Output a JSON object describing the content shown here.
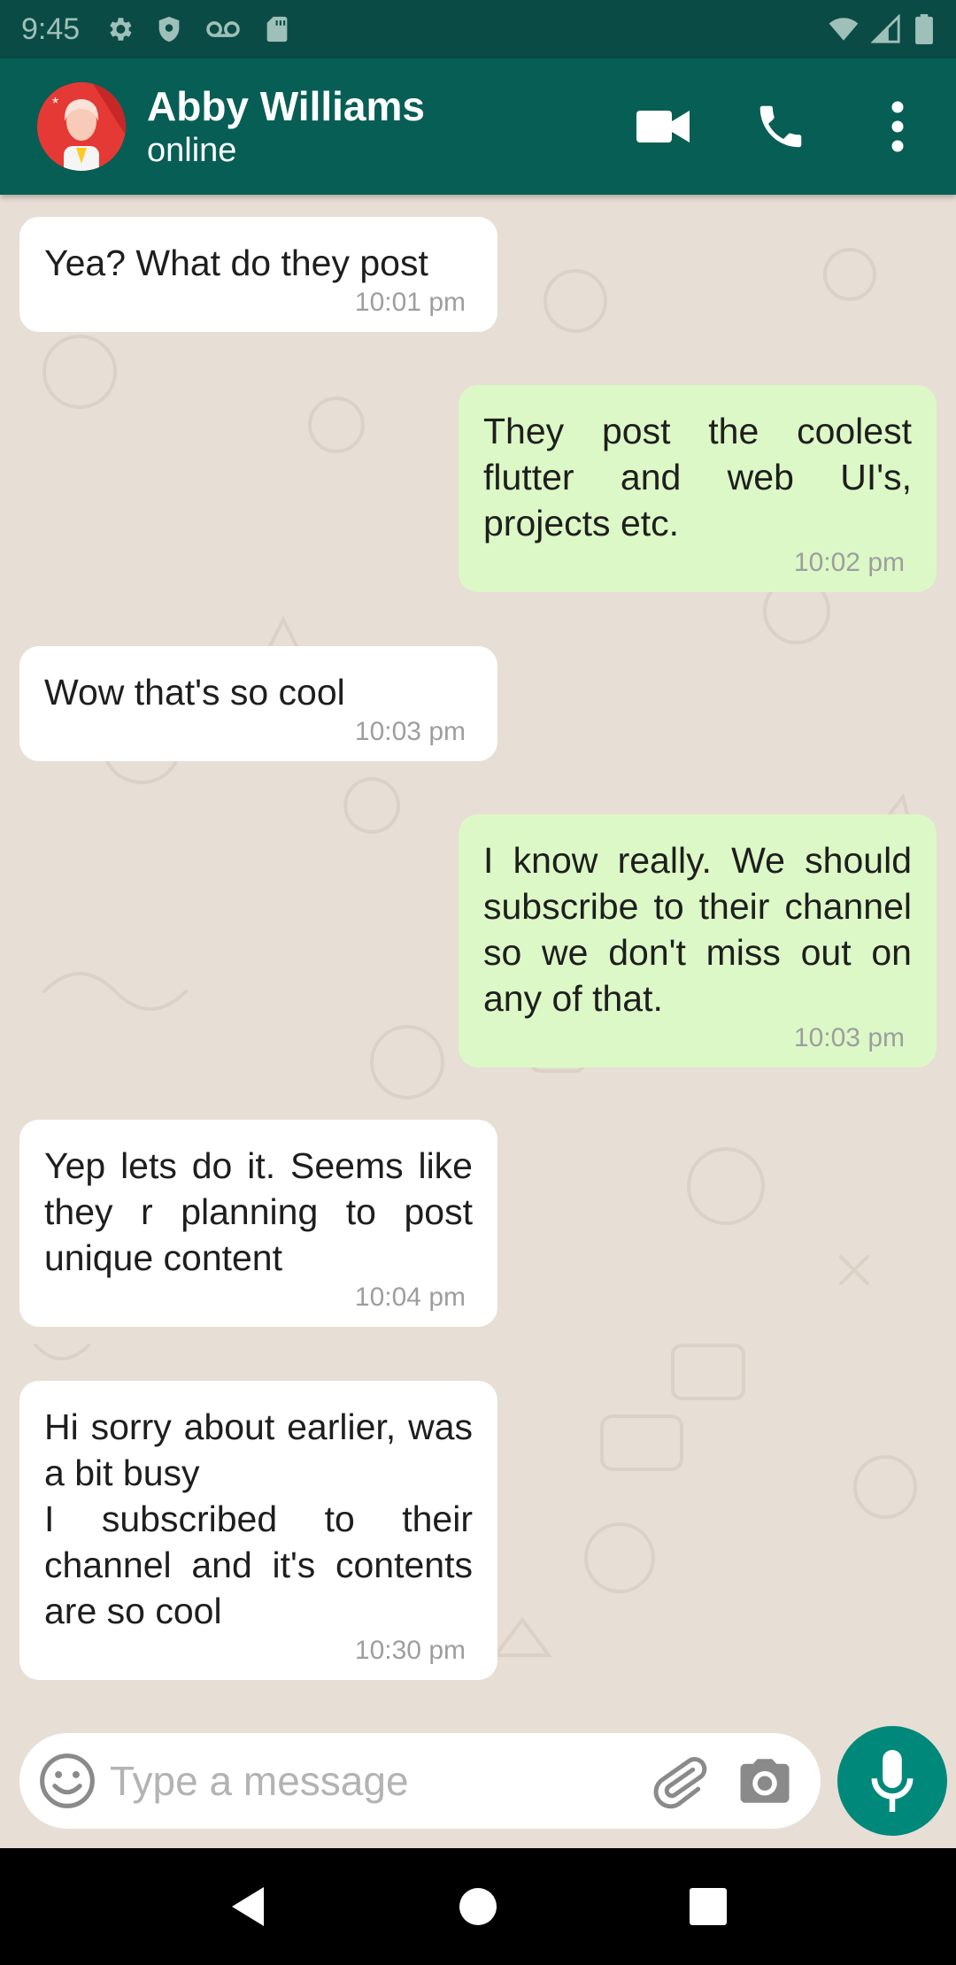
{
  "status_bar": {
    "time": "9:45",
    "left_icons": [
      "settings-icon",
      "shield-icon",
      "voicemail-icon",
      "sd-card-icon"
    ],
    "right_icons": [
      "wifi-icon",
      "cell-signal-icon",
      "battery-icon"
    ]
  },
  "header": {
    "contact_name": "Abby Williams",
    "contact_status": "online",
    "actions": [
      "video-call-icon",
      "phone-icon",
      "more-vert-icon"
    ]
  },
  "messages": [
    {
      "direction": "incoming",
      "text": "Yea? What do they post",
      "time": "10:01 pm"
    },
    {
      "direction": "outgoing",
      "text": "They post the coolest flutter and web UI's, projects etc.",
      "time": "10:02 pm"
    },
    {
      "direction": "incoming",
      "text": "Wow that's so cool",
      "time": "10:03 pm"
    },
    {
      "direction": "outgoing",
      "text": "I know really. We should subscribe to their channel so we don't miss out on any of that.",
      "time": "10:03 pm"
    },
    {
      "direction": "incoming",
      "text": "Yep lets do it. Seems like they r planning to post unique content",
      "time": "10:04 pm"
    },
    {
      "direction": "incoming",
      "text": "Hi sorry about earlier, was a bit busy\n I subscribed to their channel and it's contents are so cool",
      "time": "10:30 pm"
    }
  ],
  "composer": {
    "placeholder": "Type a message",
    "value": "",
    "icons": [
      "emoji-icon",
      "attach-icon",
      "camera-icon"
    ],
    "send_icon": "mic-icon"
  },
  "nav_bar": {
    "buttons": [
      "back-icon",
      "home-icon",
      "recents-icon"
    ]
  },
  "colors": {
    "header": "#075e54",
    "status_bar": "#0a4c45",
    "chat_background": "#e7ded5",
    "incoming_bubble": "#ffffff",
    "outgoing_bubble": "#dcf8c6",
    "mic_button": "#00897b"
  }
}
